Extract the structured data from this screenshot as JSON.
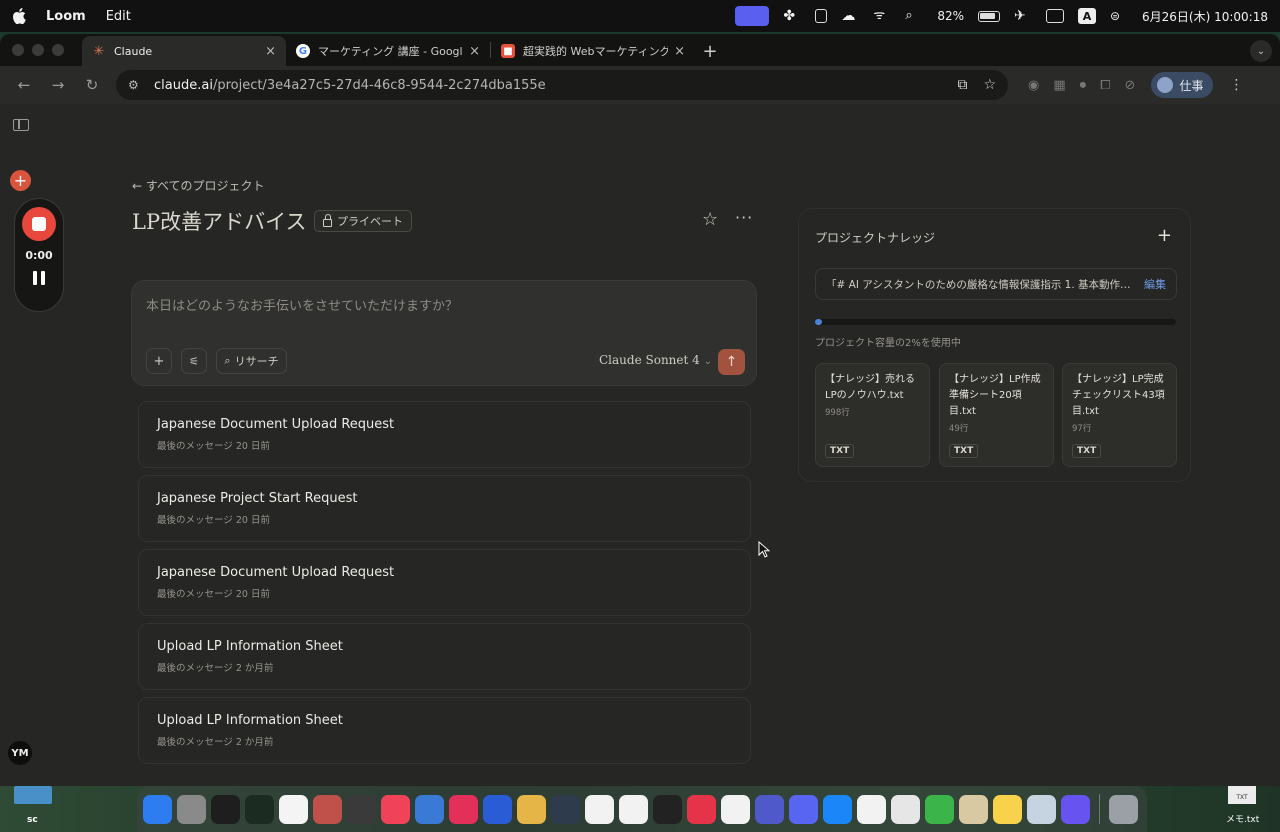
{
  "menubar": {
    "app_name": "Loom",
    "menu_edit": "Edit",
    "battery": "82%",
    "input_source": "A",
    "datetime": "6月26日(木) 10:00:18"
  },
  "tabs": [
    {
      "title": "Claude",
      "icon": "claude-icon"
    },
    {
      "title": "マーケティング 講座 - Google 検索",
      "icon": "google-icon"
    },
    {
      "title": "超実践的 Webマーケティングスクール",
      "icon": "site-icon"
    }
  ],
  "address": {
    "host": "claude.ai",
    "path": "/project/3e4a27c5-27d4-46c8-9544-2c274dba155e"
  },
  "profile_label": "仕事",
  "loom": {
    "timer": "0:00"
  },
  "rail": {
    "avatar": "YM"
  },
  "project": {
    "back_link": "← すべてのプロジェクト",
    "title": "LP改善アドバイス",
    "visibility": "プライベート"
  },
  "composer": {
    "placeholder": "本日はどのようなお手伝いをさせていただけますか？",
    "research_label": "リサーチ",
    "model": "Claude Sonnet 4"
  },
  "chats": [
    {
      "title": "Japanese Document Upload Request",
      "subtitle": "最後のメッセージ 20 日前"
    },
    {
      "title": "Japanese Project Start Request",
      "subtitle": "最後のメッセージ 20 日前"
    },
    {
      "title": "Japanese Document Upload Request",
      "subtitle": "最後のメッセージ 20 日前"
    },
    {
      "title": "Upload LP Information Sheet",
      "subtitle": "最後のメッセージ 2 か月前"
    },
    {
      "title": "Upload LP Information Sheet",
      "subtitle": "最後のメッセージ 2 か月前"
    }
  ],
  "knowledge": {
    "heading": "プロジェクトナレッジ",
    "instructions": "「# AI アシスタントのための厳格な情報保護指示 1. 基本動作原則: ...",
    "edit_label": "編集",
    "capacity_fraction": 0.02,
    "capacity_text": "プロジェクト容量の2%を使用中",
    "files": [
      {
        "name": "【ナレッジ】売れるLPのノウハウ.txt",
        "lines": "998行",
        "type": "TXT"
      },
      {
        "name": "【ナレッジ】LP作成準備シート20項目.txt",
        "lines": "49行",
        "type": "TXT"
      },
      {
        "name": "【ナレッジ】LP完成チェックリスト43項目.txt",
        "lines": "97行",
        "type": "TXT"
      }
    ]
  },
  "desktop": {
    "left_label": "sc",
    "right_label": "メモ.txt",
    "right_icon_text": "TXT"
  },
  "dock": [
    {
      "icon": "finder-icon",
      "color": "#2d7cf0"
    },
    {
      "icon": "system-settings-icon",
      "color": "#8a8a8a"
    },
    {
      "icon": "terminal-icon",
      "color": "#1e1e1e"
    },
    {
      "icon": "activity-monitor-icon",
      "color": "#1b2b22"
    },
    {
      "icon": "freeform-icon",
      "color": "#f4f4f4"
    },
    {
      "icon": "app-icon",
      "color": "#c0504a"
    },
    {
      "icon": "calculator-icon",
      "color": "#3a3a3a"
    },
    {
      "icon": "music-icon",
      "color": "#f0435a"
    },
    {
      "icon": "xcode-icon",
      "color": "#3b79d6"
    },
    {
      "icon": "app-x-icon",
      "color": "#e2305b"
    },
    {
      "icon": "app-m-icon",
      "color": "#2a5cd6"
    },
    {
      "icon": "folder-icon",
      "color": "#e5b547"
    },
    {
      "icon": "quicktime-icon",
      "color": "#2e3b4c"
    },
    {
      "icon": "chrome-icon",
      "color": "#f2f2f2"
    },
    {
      "icon": "chatgpt-icon",
      "color": "#f2f2f2"
    },
    {
      "icon": "audio-icon",
      "color": "#222"
    },
    {
      "icon": "app-dots-icon",
      "color": "#e5334a"
    },
    {
      "icon": "slack-icon",
      "color": "#f2f2f2"
    },
    {
      "icon": "teams-icon",
      "color": "#5059c9"
    },
    {
      "icon": "discord-icon",
      "color": "#5865f2"
    },
    {
      "icon": "messenger-icon",
      "color": "#1b86f8"
    },
    {
      "icon": "textedit-icon",
      "color": "#f2f2f2"
    },
    {
      "icon": "pages-icon",
      "color": "#e6e6e6"
    },
    {
      "icon": "numbers-icon",
      "color": "#3bb54a"
    },
    {
      "icon": "preview-icon",
      "color": "#d8c9a3"
    },
    {
      "icon": "notes-icon",
      "color": "#f7d24a"
    },
    {
      "icon": "screenshot-icon",
      "color": "#c6d3e0"
    },
    {
      "icon": "loom-icon",
      "color": "#6653f0"
    },
    {
      "icon": "trash-icon",
      "color": "#9aa0a6"
    }
  ]
}
